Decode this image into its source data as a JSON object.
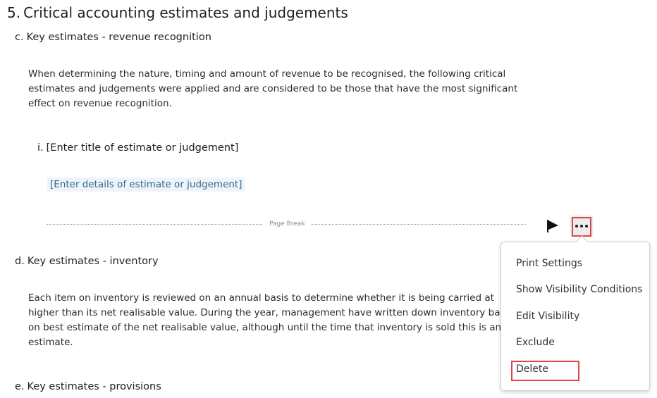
{
  "section": {
    "number": "5.",
    "title": "Critical accounting estimates and judgements"
  },
  "sub_c": {
    "letter": "c.",
    "title": "Key estimates - revenue recognition",
    "paragraph_lines": [
      "When determining the nature, timing and amount of revenue to be recognised, the following critical",
      "estimates and judgements were applied and are considered to be those that have the most significant",
      "effect on revenue recognition."
    ]
  },
  "sub_i": {
    "numeral": "i.",
    "title": "[Enter title of estimate or judgement]",
    "details": "[Enter details of estimate or judgement]"
  },
  "page_break": {
    "label": "Page Break"
  },
  "sub_d": {
    "letter": "d.",
    "title": "Key estimates - inventory",
    "paragraph_lines": [
      "Each item on inventory is reviewed on an annual basis to determine whether it is being carried at",
      "higher than its net realisable value. During the year, management have written down inventory based",
      "on best estimate of the net realisable value, although until the time that inventory is sold this is an",
      "estimate."
    ]
  },
  "sub_e": {
    "letter": "e.",
    "title": "Key estimates - provisions"
  },
  "context_menu": {
    "items": [
      "Print Settings",
      "Show Visibility Conditions",
      "Edit Visibility",
      "Exclude",
      "Delete"
    ]
  },
  "icons": {
    "flag": "flag-icon",
    "more": "more-options-icon"
  },
  "colors": {
    "highlight_border": "#e04545",
    "placeholder_text": "#2f6a94",
    "placeholder_bg": "#eef4f8"
  }
}
